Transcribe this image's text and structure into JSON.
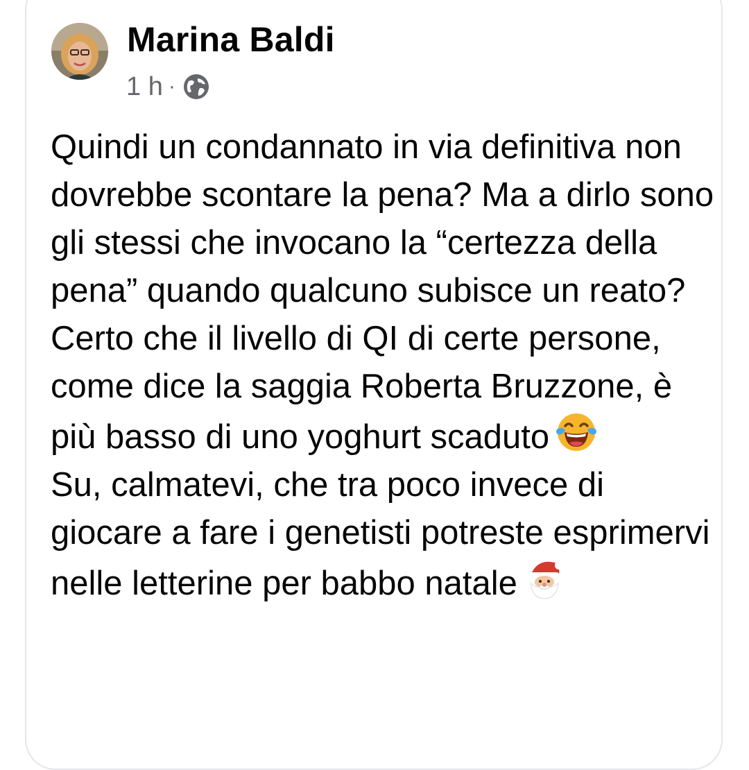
{
  "post": {
    "author": "Marina Baldi",
    "time": "1 h",
    "separator": "·",
    "privacy_icon": "globe-icon",
    "paragraphs": [
      "Quindi un condannato in via definitiva non dovrebbe scontare la pena? Ma a dirlo sono gli stessi che invocano la “certezza della pena” quando qualcuno subisce un reato? Certo che il livello di QI di certe persone, come dice la saggia Roberta Bruzzone, è più basso di uno yoghurt scaduto",
      "Su, calmatevi, che tra poco invece di giocare a fare i genetisti potreste esprimervi nelle letterine per babbo natale"
    ],
    "emojis": [
      "tears-of-joy-emoji",
      "santa-claus-emoji"
    ]
  },
  "colors": {
    "text": "#050505",
    "meta": "#65676b",
    "border": "#e4e6eb"
  }
}
